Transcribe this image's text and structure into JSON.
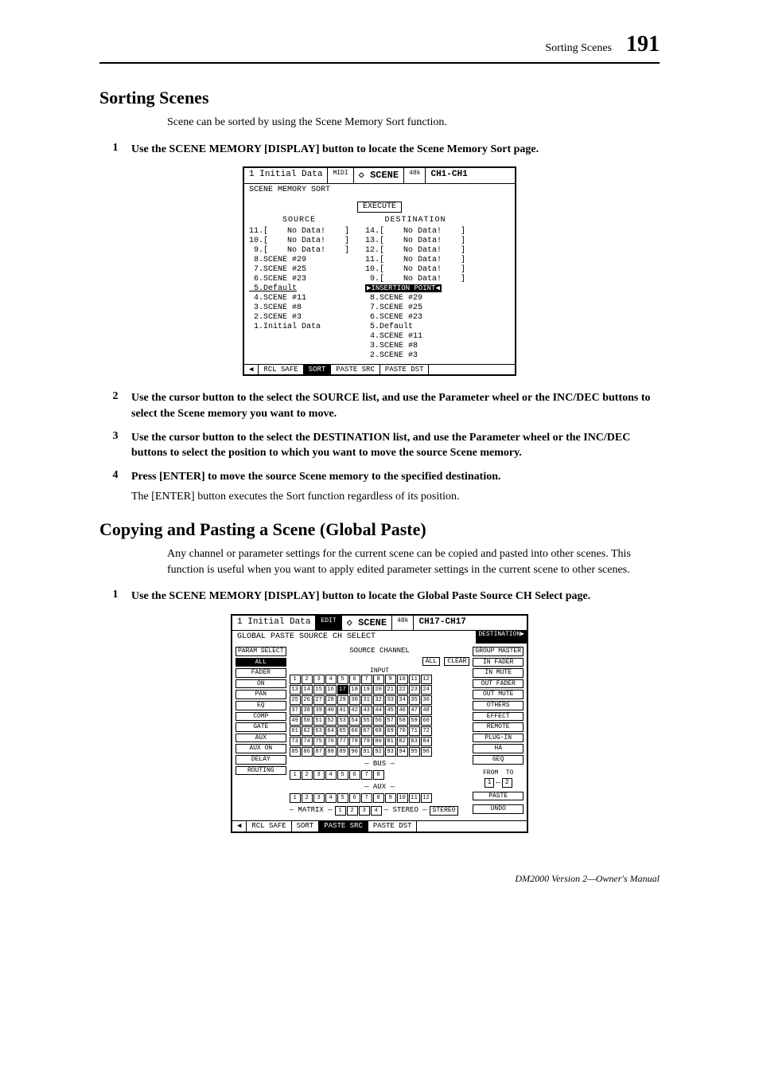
{
  "header": {
    "title": "Sorting Scenes",
    "page": "191"
  },
  "s1": {
    "heading": "Sorting Scenes",
    "intro": "Scene can be sorted by using the Scene Memory Sort function.",
    "steps": [
      {
        "n": "1",
        "t": "Use the SCENE MEMORY [DISPLAY] button to locate the Scene Memory Sort page."
      },
      {
        "n": "2",
        "t": "Use the cursor button to the select the SOURCE list, and use the Parameter wheel or the INC/DEC buttons to select the Scene memory you want to move."
      },
      {
        "n": "3",
        "t": "Use the cursor button to the select the DESTINATION list, and use the Parameter wheel or the INC/DEC buttons to select the position to which you want to move the source Scene memory."
      },
      {
        "n": "4",
        "t": "Press [ENTER] to move the source Scene memory to the specified destination.",
        "b": "The [ENTER] button executes the Sort function regardless of its position."
      }
    ]
  },
  "fig1": {
    "top": {
      "slot": "1",
      "name": "Initial Data",
      "midi": "MIDI",
      "scene": "◇ SCENE",
      "rate": "48k",
      "ch": "CH1-CH1"
    },
    "pagename": "SCENE MEMORY SORT",
    "execute": "EXECUTE",
    "src_head": "SOURCE",
    "dst_head": "DESTINATION",
    "src": [
      "11.[    No Data!    ]",
      "10.[    No Data!    ]",
      " 9.[    No Data!    ]",
      " 8.SCENE #29",
      " 7.SCENE #25",
      " 6.SCENE #23",
      " 5.Default",
      " 4.SCENE #11",
      " 3.SCENE #8",
      " 2.SCENE #3",
      " 1.Initial Data"
    ],
    "dst": [
      "14.[    No Data!    ]",
      "13.[    No Data!    ]",
      "12.[    No Data!    ]",
      "11.[    No Data!    ]",
      "10.[    No Data!    ]",
      " 9.[    No Data!    ]",
      "▶INSERTION POINT◀",
      " 8.SCENE #29",
      " 7.SCENE #25",
      " 6.SCENE #23",
      " 5.Default",
      " 4.SCENE #11",
      " 3.SCENE #8",
      " 2.SCENE #3"
    ],
    "tabs": [
      "◀",
      "RCL SAFE",
      "SORT",
      "PASTE SRC",
      "PASTE DST"
    ]
  },
  "s2": {
    "heading": "Copying and Pasting a Scene (Global Paste)",
    "intro": "Any channel or parameter settings for the current scene can be copied and pasted into other scenes. This function is useful when you want to apply edited parameter settings in the current scene to other scenes.",
    "steps": [
      {
        "n": "1",
        "t": "Use the SCENE MEMORY [DISPLAY] button to locate the Global Paste Source CH Select page."
      }
    ]
  },
  "fig2": {
    "top": {
      "slot": "1",
      "name": "Initial Data",
      "edit": "EDIT",
      "scene": "◇ SCENE",
      "rate": "48k",
      "ch": "CH17-CH17"
    },
    "pagename": "GLOBAL PASTE SOURCE CH SELECT",
    "dest_tab": "DESTINATION▶",
    "left": [
      "PARAM SELECT",
      "ALL",
      "FADER",
      "ON",
      "PAN",
      "EQ",
      "COMP",
      "GATE",
      "AUX",
      "AUX ON",
      "DELAY",
      "ROUTING"
    ],
    "left_filled": "ALL",
    "center_title": "SOURCE CHANNEL",
    "all": "ALL",
    "clear": "CLEAR",
    "input_label": "INPUT",
    "bus_label": "BUS",
    "aux_label": "AUX",
    "matrix_label": "MATRIX",
    "stereo_label": "STEREO",
    "stereo_btn": "STEREO",
    "input_filled": [
      17
    ],
    "bus_count": 8,
    "aux_count": 12,
    "matrix_count": 4,
    "right": [
      "GROUP MASTER",
      "IN FADER",
      "IN MUTE",
      "OUT FADER",
      "OUT MUTE",
      "OTHERS",
      "EFFECT",
      "REMOTE",
      "PLUG-IN",
      "HA",
      "GEQ"
    ],
    "from": "FROM",
    "to": "TO",
    "from_v": "1",
    "to_v": "2",
    "paste": "PASTE",
    "undo": "UNDO",
    "tabs": [
      "◀",
      "RCL SAFE",
      "SORT",
      "PASTE SRC",
      "PASTE DST"
    ]
  },
  "footer": "DM2000 Version 2—Owner's Manual"
}
